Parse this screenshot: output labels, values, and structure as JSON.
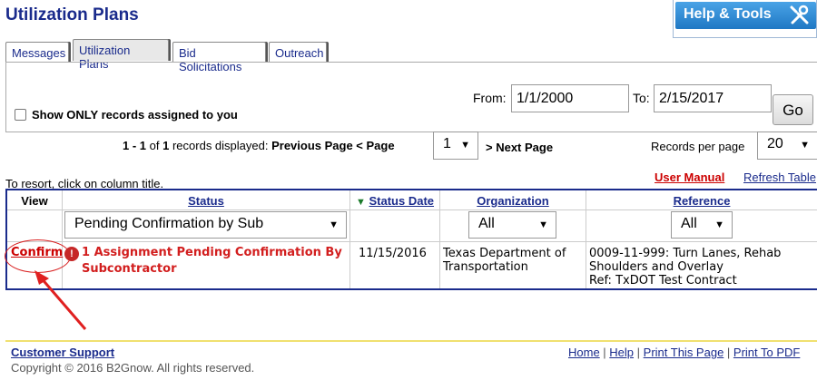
{
  "page": {
    "title": "Utilization Plans"
  },
  "help": {
    "label": "Help & Tools",
    "icon": "tools-icon"
  },
  "tabs": [
    {
      "label": "Messages",
      "active": false
    },
    {
      "label": "Utilization Plans",
      "active": true
    },
    {
      "label": "Bid Solicitations",
      "active": false
    },
    {
      "label": "Outreach",
      "active": false
    }
  ],
  "filter": {
    "checkbox_label": "Show ONLY records assigned to you",
    "from_label": "From:",
    "from_value": "1/1/2000",
    "to_label": "To:",
    "to_value": "2/15/2017",
    "go_label": "Go"
  },
  "pager": {
    "range": "1 - 1",
    "of": "of",
    "total": "1",
    "records_displayed": "records displayed:",
    "previous": "Previous Page < Page",
    "page_value": "1",
    "next": "> Next Page",
    "records_per_page_label": "Records per page",
    "records_per_page_value": "20"
  },
  "resort_hint": "To resort, click on column title.",
  "links": {
    "user_manual": "User Manual",
    "refresh": "Refresh Table"
  },
  "table": {
    "headers": {
      "view": "View",
      "status": "Status",
      "status_date": "Status Date",
      "organization": "Organization",
      "reference": "Reference"
    },
    "filters": {
      "status": "Pending Confirmation by Sub",
      "organization": "All",
      "reference": "All"
    },
    "rows": [
      {
        "view": "Confirm",
        "status": "1 Assignment Pending Confirmation By Subcontractor",
        "status_date": "11/15/2016",
        "organization": "Texas Department of Transportation",
        "reference": [
          "0009-11-999: Turn Lanes, Rehab",
          "Shoulders and Overlay",
          "Ref: TxDOT Test Contract"
        ]
      }
    ]
  },
  "footer": {
    "customer_support": "Customer Support",
    "copyright": "Copyright © 2016 B2Gnow. All rights reserved.",
    "links": [
      "Home",
      "Help",
      "Print This Page",
      "Print To PDF"
    ]
  },
  "colors": {
    "title": "#1a2b8c",
    "alert": "#d21e1e",
    "annotation": "#e02020"
  }
}
